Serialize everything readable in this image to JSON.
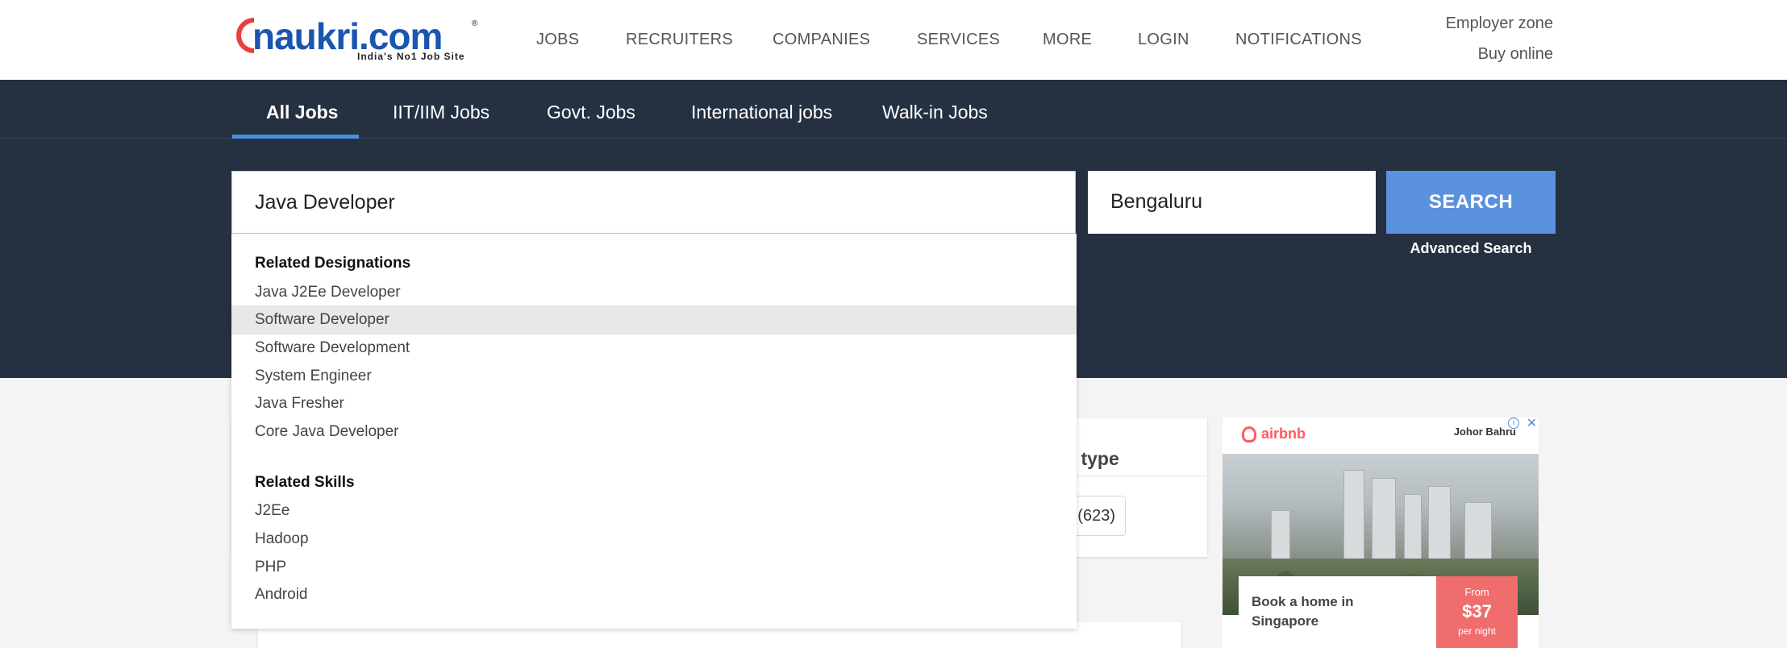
{
  "header": {
    "logo": {
      "brand": "naukri.com",
      "tagline": "India's No1 Job Site"
    },
    "nav": [
      "JOBS",
      "RECRUITERS",
      "COMPANIES",
      "SERVICES",
      "MORE",
      "LOGIN",
      "NOTIFICATIONS"
    ],
    "employer_zone": "Employer zone",
    "buy_online": "Buy online"
  },
  "tabs": [
    "All Jobs",
    "IIT/IIM Jobs",
    "Govt. Jobs",
    "International jobs",
    "Walk-in Jobs"
  ],
  "search": {
    "keyword_value": "Java Developer",
    "location_value": "Bengaluru",
    "button_label": "SEARCH",
    "advanced_label": "Advanced Search"
  },
  "dropdown": {
    "designations_heading": "Related Designations",
    "designations": [
      "Java J2Ee Developer",
      "Software Developer",
      "Software Development",
      "System Engineer",
      "Java Fresher",
      "Core Java Developer"
    ],
    "highlighted": "Software Developer",
    "skills_heading": "Related Skills",
    "skills": [
      "J2Ee",
      "Hadoop",
      "PHP",
      "Android"
    ]
  },
  "filters": {
    "job_type_label": "b type",
    "chip_count": "(623)"
  },
  "ad": {
    "brand": "airbnb",
    "location": "Johor Bahru",
    "headline": "Book a home in Singapore",
    "price_from": "From",
    "price": "$37",
    "price_unit": "per night",
    "colors": {
      "brand": "#ff5a5f",
      "price_bg": "#f06d6d"
    }
  },
  "colors": {
    "header_bg": "#ffffff",
    "band_bg": "#253040",
    "accent": "#5b92de"
  }
}
